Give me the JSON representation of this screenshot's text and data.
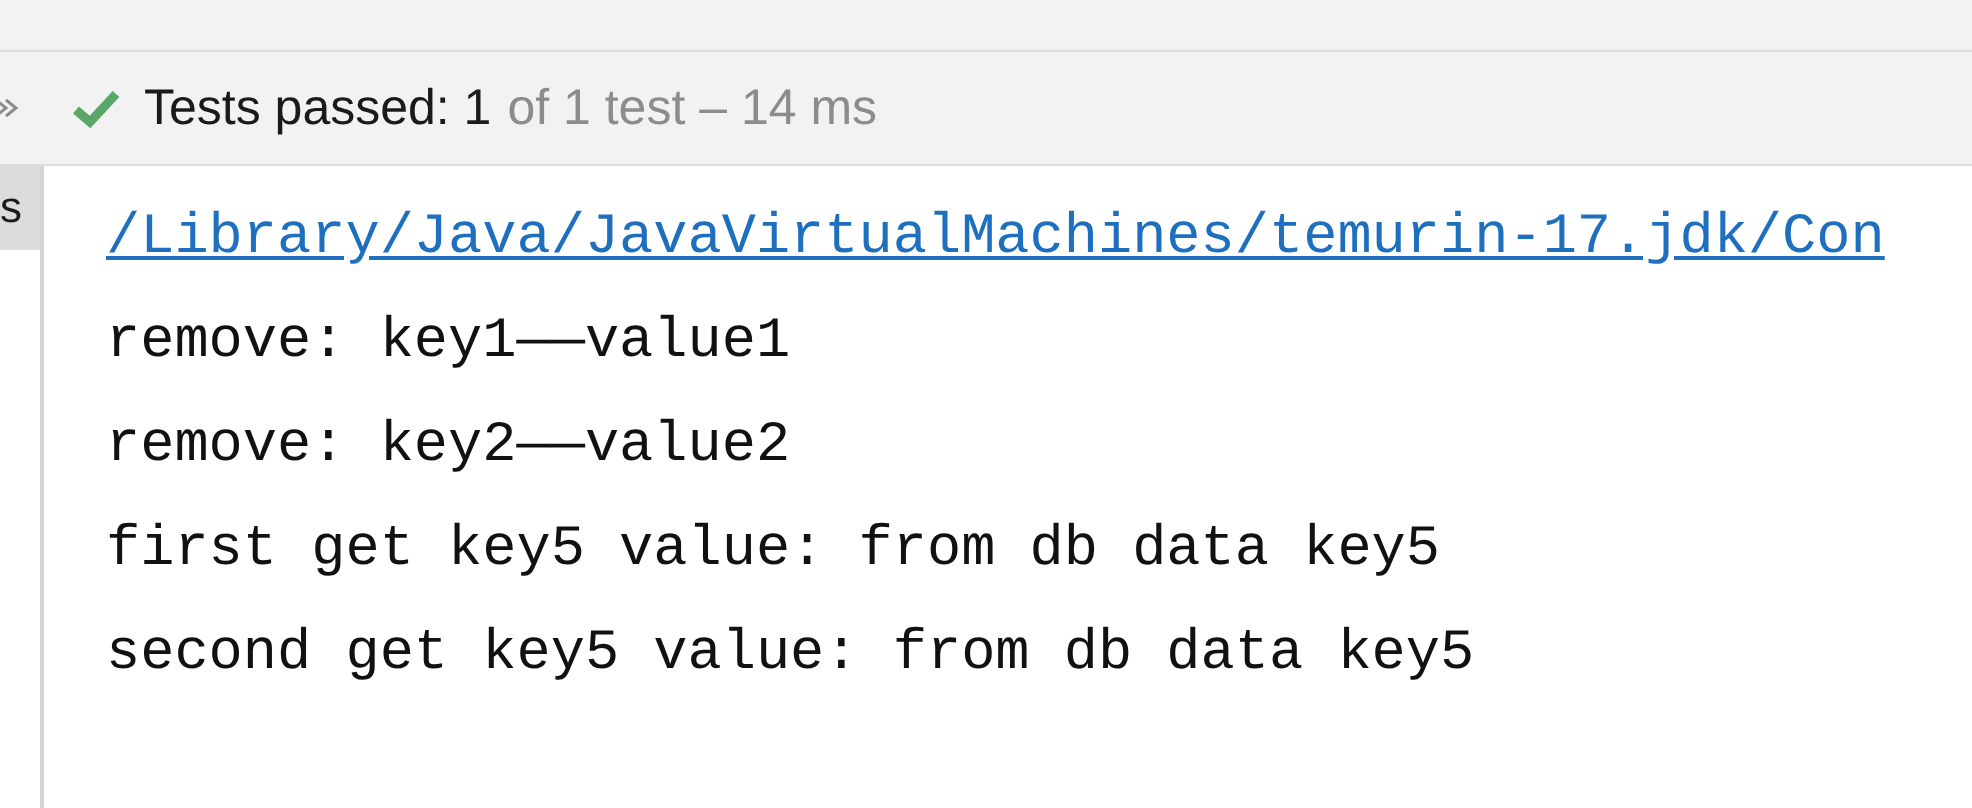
{
  "status_bar": {
    "kind": "passed",
    "summary": "Tests passed: 1",
    "detail": "of 1 test – 14 ms"
  },
  "side_tab": {
    "label": "s",
    "selected": true
  },
  "console": {
    "link": "/Library/Java/JavaVirtualMachines/temurin-17.jdk/Con",
    "lines": [
      "remove: key1——value1",
      "remove: key2——value2",
      "first get key5 value: from db data key5",
      "second get key5 value: from db data key5"
    ]
  }
}
